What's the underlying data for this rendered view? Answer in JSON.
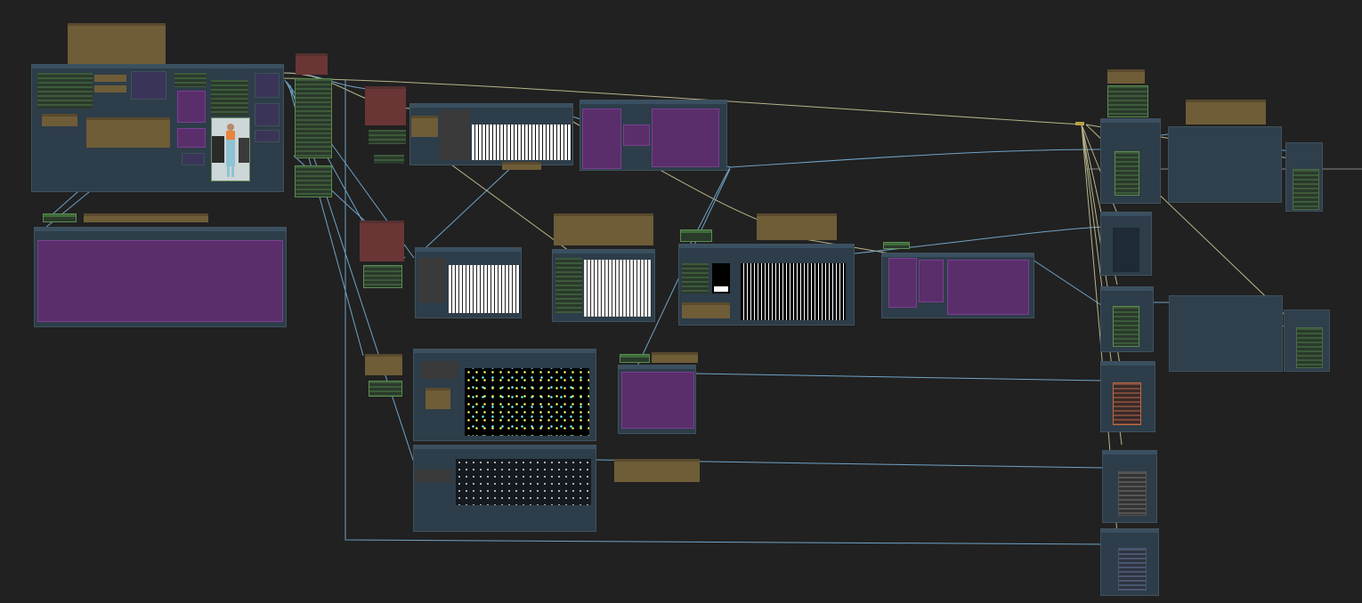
{
  "app": {
    "title": "",
    "canvas_background": "#212121"
  },
  "colors": {
    "group_fill": "#2d3d49",
    "note_fill": "#6f5d38",
    "red_node": "#6a3535",
    "green_node": "#3f6b3a",
    "purple_preview": "#5a2e6b",
    "link_blue": "#6fa3c8",
    "link_tan": "#b8b48a"
  },
  "icons": [
    "reference-photo-icon",
    "mask-preview-icon",
    "noise-preview-icon"
  ],
  "nodes": {
    "note_labels": [],
    "group_titles": []
  }
}
